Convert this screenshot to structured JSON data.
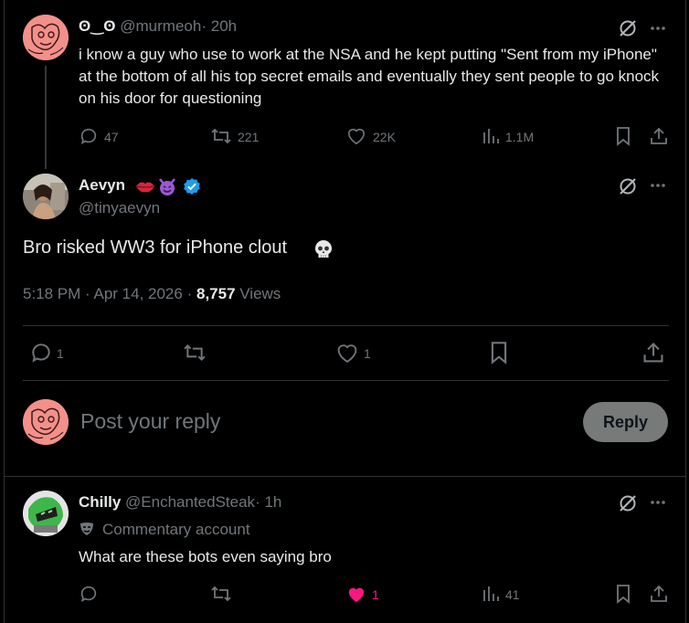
{
  "tweet1": {
    "display_name": "ʘ‿ʘ",
    "handle": "@murmeoh",
    "separator": "·",
    "time": "20h",
    "text": "i know a guy who use to work at the NSA and he kept putting \"Sent from my iPhone\" at the bottom of all his top secret emails and eventually they sent people to go knock on his door for questioning",
    "replies": "47",
    "reposts": "221",
    "likes": "22K",
    "views": "1.1M"
  },
  "main_tweet": {
    "display_name": "Aevyn",
    "name_emojis": [
      "lips-emoji",
      "smiling-devil-emoji"
    ],
    "handle": "@tinyaevyn",
    "text": "Bro risked WW3 for iPhone clout",
    "text_emoji": "skull-emoji",
    "time": "5:18 PM · Apr 14, 2026",
    "dot": "·",
    "views_count": "8,757",
    "views_label": "Views",
    "replies": "1",
    "likes": "1",
    "verified_color": "#1d9bf0"
  },
  "composer": {
    "placeholder": "Post your reply",
    "button_label": "Reply"
  },
  "reply": {
    "display_name": "Chilly",
    "handle": "@EnchantedSteak",
    "separator": "·",
    "time": "1h",
    "label": "Commentary account",
    "text": "What are these bots even saying bro",
    "likes": "1",
    "views": "41",
    "like_color": "#f91880"
  },
  "colors": {
    "background": "#000000",
    "text": "#e7e9ea",
    "muted": "#71767b",
    "divider": "#2f3336",
    "accent": "#1d9bf0"
  }
}
